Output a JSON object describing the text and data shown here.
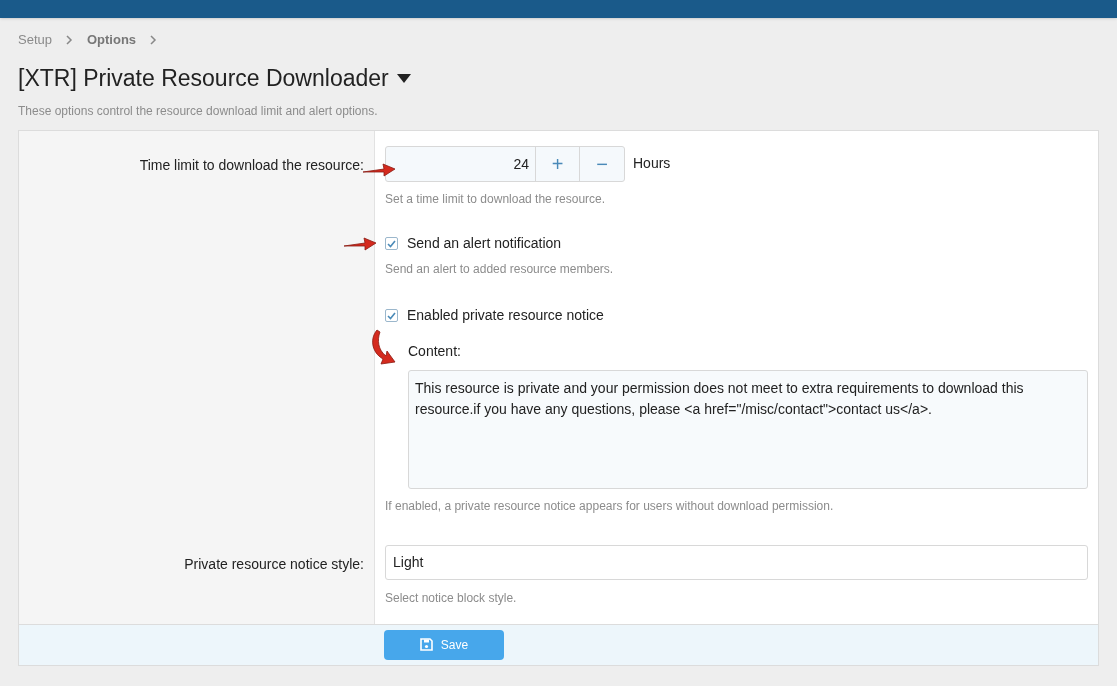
{
  "breadcrumb": [
    "Setup",
    "Options"
  ],
  "title": "[XTR] Private Resource Downloader",
  "description": "These options control the resource download limit and alert options.",
  "options": [
    {
      "kind": "spinbox",
      "label": "Time limit to download the resource:",
      "value": "24",
      "plus": "+",
      "minus": "−",
      "units": "Hours",
      "hint": "Set a time limit to download the resource."
    },
    {
      "kind": "checkbox",
      "label_text": "Send an alert notification",
      "checked": true,
      "hint": "Send an alert to added resource members."
    },
    {
      "kind": "checkbox_content",
      "label_text": "Enabled private resource notice",
      "checked": true,
      "content_label": "Content:",
      "content": "This resource is private and your permission does not meet to extra requirements to download this resource.if you have any questions, please <a href=\"/misc/contact\">contact us</a>.",
      "hint": "If enabled, a private resource notice appears for users without download permission."
    },
    {
      "kind": "select",
      "label": "Private resource notice style:",
      "value": "Light",
      "hint": "Select notice block style."
    }
  ],
  "save_button": "Save"
}
